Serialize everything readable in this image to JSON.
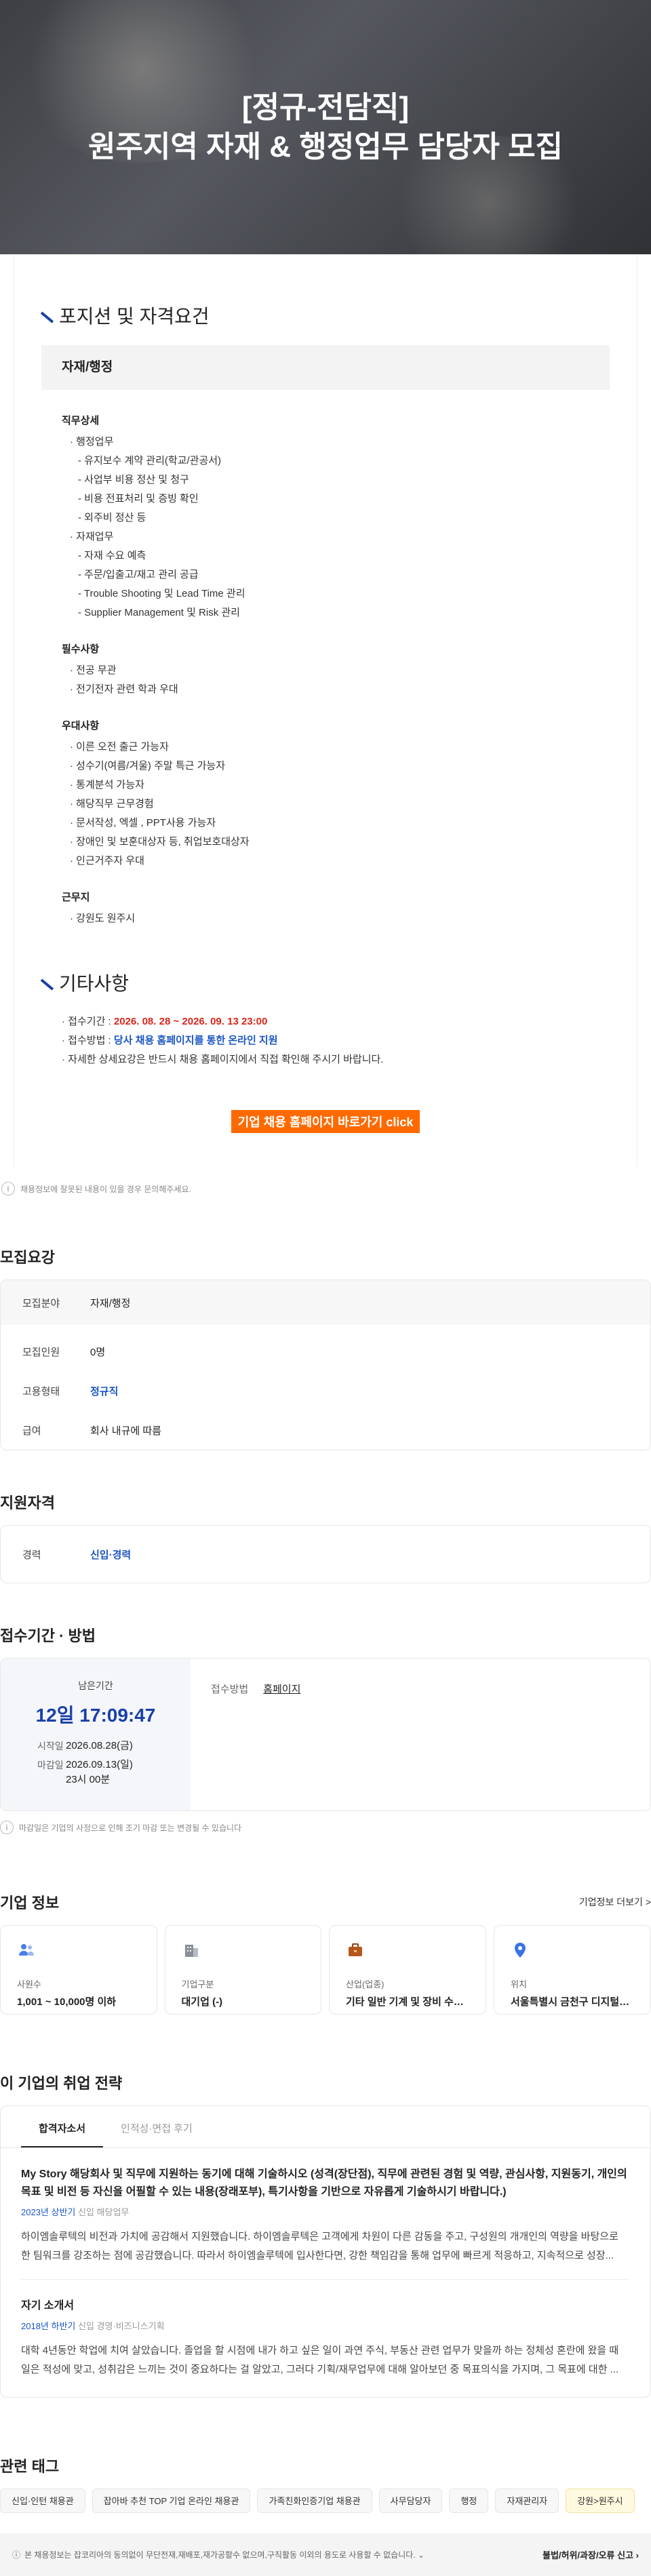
{
  "hero": {
    "line1": "[정규-전담직]",
    "line2": "원주지역 자재 & 행정업무 담당자 모집"
  },
  "jd": {
    "position_heading": "포지션 및 자격요건",
    "box_title": "자재/행정",
    "groups": [
      {
        "title": "직무상세",
        "items": [
          {
            "t": "· 행정업무",
            "sub": false
          },
          {
            "t": "- 유지보수 계약 관리(학교/관공서)",
            "sub": true
          },
          {
            "t": "- 사업부 비용 정산 및 청구",
            "sub": true
          },
          {
            "t": "- 비용 전표처리 및 증빙 확인",
            "sub": true
          },
          {
            "t": "- 외주비 정산 등",
            "sub": true
          },
          {
            "t": "· 자재업무",
            "sub": false
          },
          {
            "t": "- 자재 수요 예측",
            "sub": true
          },
          {
            "t": "- 주문/입출고/재고 관리 공급",
            "sub": true
          },
          {
            "t": "- Trouble Shooting 및 Lead Time 관리",
            "sub": true
          },
          {
            "t": "- Supplier Management 및 Risk 관리",
            "sub": true
          }
        ]
      },
      {
        "title": "필수사항",
        "items": [
          {
            "t": "· 전공 무관",
            "sub": false
          },
          {
            "t": "· 전기전자 관련 학과 우대",
            "sub": false
          }
        ]
      },
      {
        "title": "우대사항",
        "items": [
          {
            "t": "· 이른 오전 출근 가능자",
            "sub": false
          },
          {
            "t": "· 성수기(여름/겨울) 주말 특근 가능자",
            "sub": false
          },
          {
            "t": "· 통계분석 가능자",
            "sub": false
          },
          {
            "t": "· 해당직무 근무경험",
            "sub": false
          },
          {
            "t": "· 문서작성, 엑셀 , PPT사용 가능자",
            "sub": false
          },
          {
            "t": "· 장애인 및 보훈대상자 등, 취업보호대상자",
            "sub": false
          },
          {
            "t": "· 인근거주자 우대",
            "sub": false
          }
        ]
      },
      {
        "title": "근무지",
        "items": [
          {
            "t": "· 강원도 원주시",
            "sub": false
          }
        ]
      }
    ],
    "etc_heading": "기타사항",
    "period_prefix": "· 접수기간 : ",
    "period_value": "2026. 08. 28 ~ 2026. 09. 13 23:00",
    "method_prefix": "· 접수방법 : ",
    "method_value": "당사 채용 홈페이지를 통한 온라인 지원",
    "detail_line": "· 자세한 상세요강은 반드시 채용 홈페이지에서 직접 확인해 주시기 바랍니다.",
    "cta": "기업 채용 홈페이지 바로가기 click"
  },
  "notice1": "채용정보에 잘못된 내용이 있을 경우 문의해주세요.",
  "recruit": {
    "title": "모집요강",
    "rows": [
      {
        "k": "모집분야",
        "v": "자재/행정"
      },
      {
        "k": "모집인원",
        "v": "0명"
      },
      {
        "k": "고용형태",
        "v": "정규직"
      },
      {
        "k": "급여",
        "v": "회사 내규에 따름"
      }
    ]
  },
  "qual": {
    "title": "지원자격",
    "k": "경력",
    "v": "신입·경력"
  },
  "period": {
    "title": "접수기간 · 방법",
    "remain_label": "남은기간",
    "remain_value": "12일 17:09:47",
    "start_k": "시작일",
    "start_v": "2026.08.28(금)",
    "end_k": "마감일",
    "end_v1": "2026.09.13(일)",
    "end_v2": "23시 00분",
    "method_k": "접수방법",
    "method_v": "홈페이지"
  },
  "notice2": "마감일은 기업의 사정으로 인해 조기 마감 또는 변경될 수 있습니다",
  "company": {
    "title": "기업 정보",
    "more": "기업정보 더보기 >",
    "cards": [
      {
        "icon": "people-icon",
        "k": "사원수",
        "v": "1,001 ~ 10,000명 이하"
      },
      {
        "icon": "building-icon",
        "k": "기업구분",
        "v": "대기업 (-)"
      },
      {
        "icon": "briefcase-icon",
        "k": "산업(업종)",
        "v": "기타 일반 기계 및 장비 수리업"
      },
      {
        "icon": "location-pin-icon",
        "k": "위치",
        "v": "서울특별시 금천구 디지털로10..."
      }
    ]
  },
  "strategy": {
    "title": "이 기업의 취업 전략",
    "tabs": [
      "합격자소서",
      "인적성·면접 후기"
    ],
    "stories": [
      {
        "title": "My Story 해당회사 및 직무에 지원하는 동기에 대해 기술하시오 (성격(장단점), 직무에 관련된 경험 및 역량, 관심사항, 지원동기, 개인의 목표 및 비전 등 자신을 어필할 수 있는 내용(장래포부), 특기사항을 기반으로 자유롭게 기술하시기 바랍니다.)",
        "year": "2023년 상반기",
        "type": "신입",
        "job": "해당업무",
        "body": "하이엠솔루텍의 비전과 가치에 공감해서 지원했습니다. 하이엠솔루텍은 고객에게 차원이 다른 감동을 주고, 구성원의 개개인의 역량을 바탕으로 한 팀워크를 강조하는 점에 공감했습니다. 따라서 하이엠솔루텍에 입사한다면, 강한 책임감을 통해 업무에 빠르게 적응하고, 지속적으로 성장..."
      },
      {
        "title": "자기 소개서",
        "year": "2018년 하반기",
        "type": "신입",
        "job": "경영·비즈니스기획",
        "body": "대학 4년동안 학업에 치여 살았습니다. 졸업을 할 시점에 내가 하고 싶은 일이 과연 주식, 부동산 관련 업무가 맞을까 하는 정체성 혼란에 왔을 때 일은 적성에 맞고, 성취감은 느끼는 것이 중요하다는 걸 알았고, 그러다 기획/재무업무에 대해 알아보던 중 목표의식을 가지며, 그 목표에 대한 ..."
      }
    ]
  },
  "tags": {
    "title": "관련 태그",
    "items": [
      {
        "t": "신입·인턴 채용관",
        "hl": false
      },
      {
        "t": "잡아바 추천 TOP 기업 온라인 채용관",
        "hl": false
      },
      {
        "t": "가족친화인증기업 채용관",
        "hl": false
      },
      {
        "t": "사무담당자",
        "hl": false
      },
      {
        "t": "행정",
        "hl": false
      },
      {
        "t": "자재관리자",
        "hl": false
      },
      {
        "t": "강원>원주시",
        "hl": true
      }
    ]
  },
  "footer": {
    "text": "본 채용정보는 잡코리아의 동의없이 무단전재,재배포,재가공할수 없으며,구직활동 이외의 용도로 사용할 수 없습니다.",
    "report": "불법/허위/과장/오류 신고"
  }
}
